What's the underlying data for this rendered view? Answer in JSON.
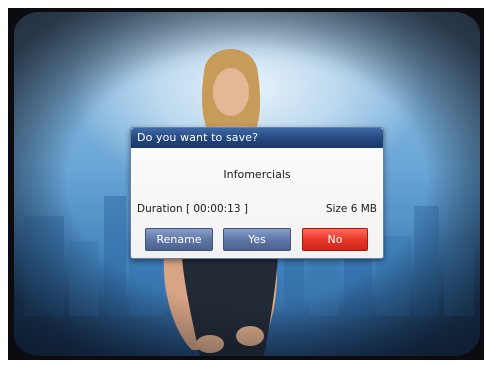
{
  "dialog": {
    "title": "Do you want to save?",
    "recording_name": "Infomercials",
    "duration_text": "Duration [ 00:00:13 ]",
    "size_text": "Size 6 MB",
    "buttons": {
      "rename": "Rename",
      "yes": "Yes",
      "no": "No"
    }
  },
  "colors": {
    "title_bar": "#24467d",
    "button_normal": "#5f77a6",
    "button_focused": "#e8382b",
    "background_sky": "#6aa6d6"
  },
  "icons": {
    "presenter": "presenter-figure",
    "background": "city-skyline"
  }
}
